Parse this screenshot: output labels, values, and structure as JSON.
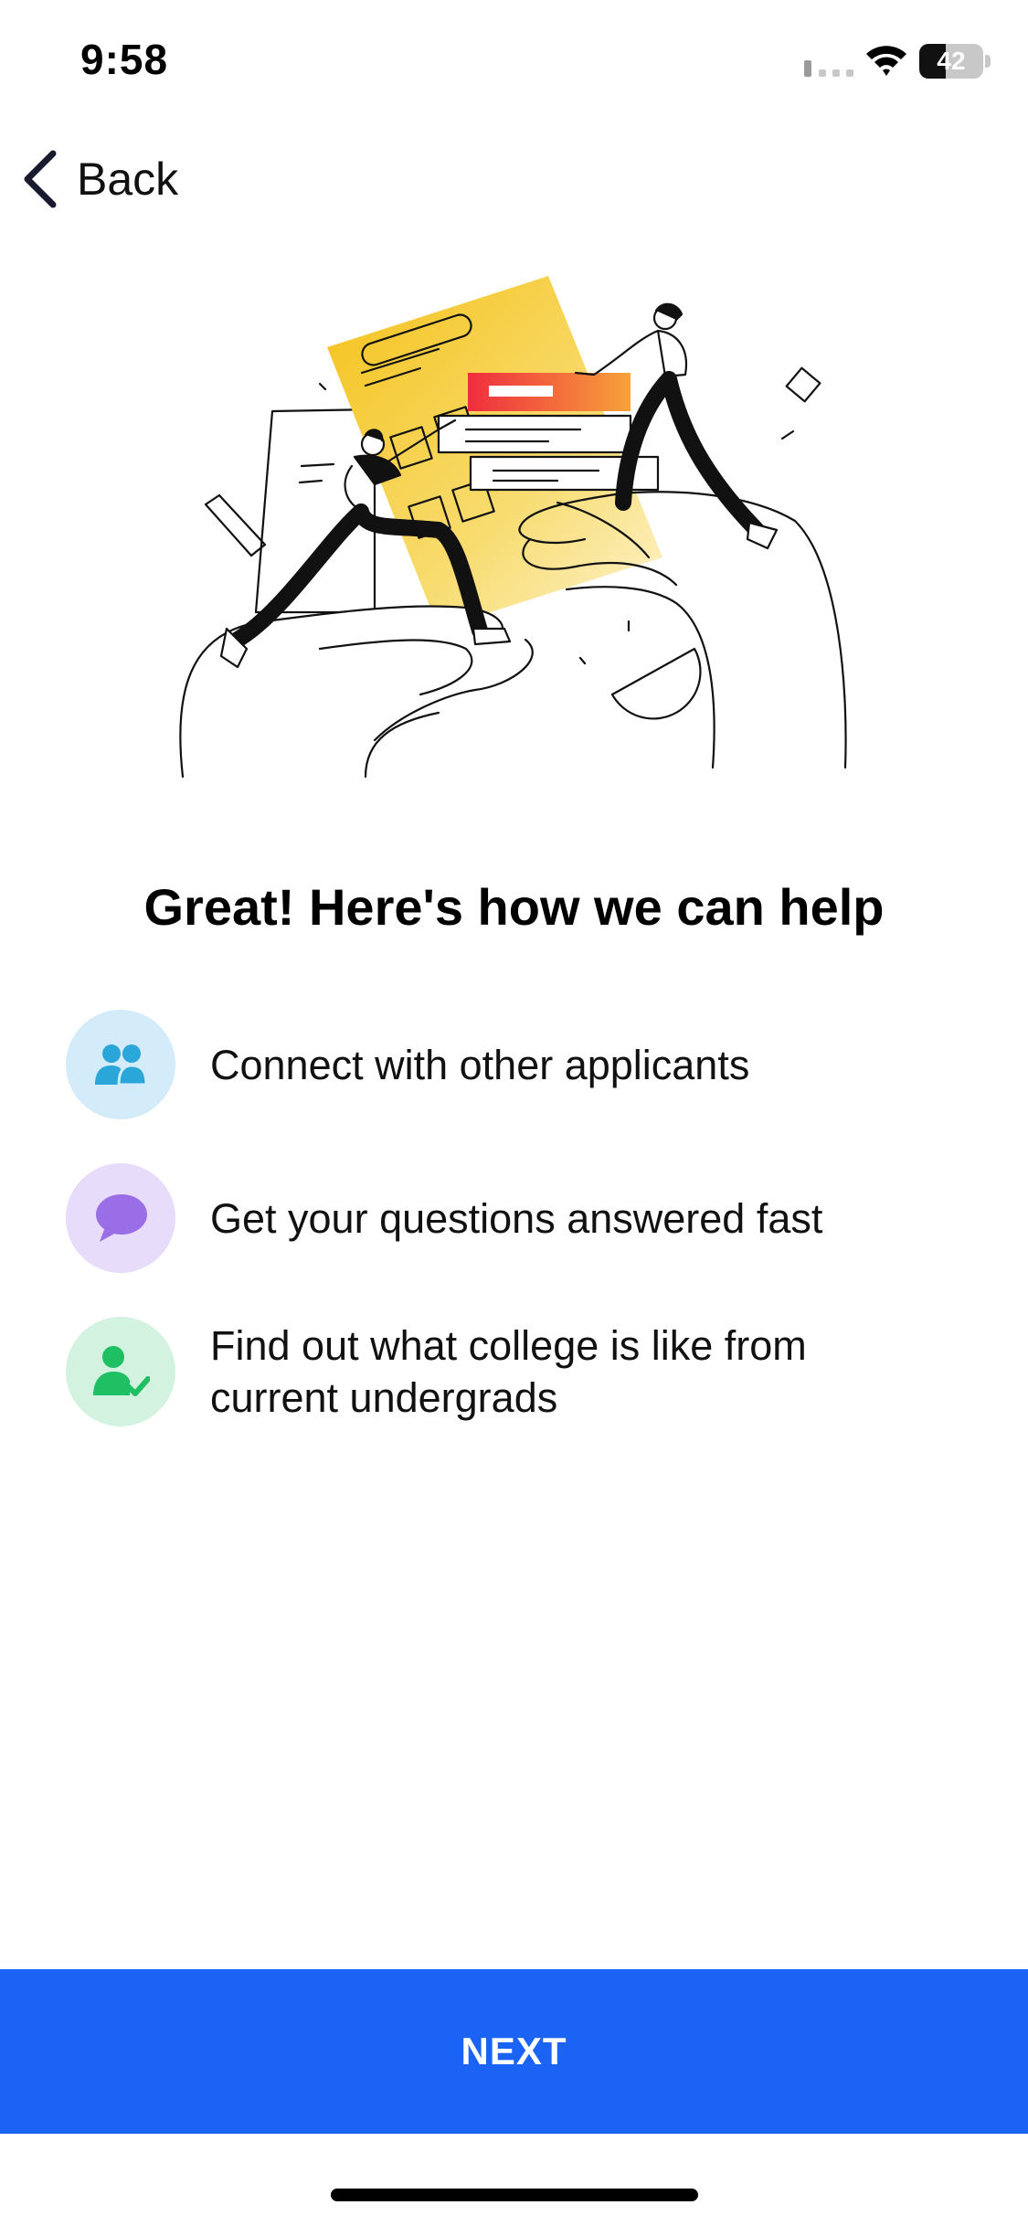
{
  "status_bar": {
    "time": "9:58",
    "battery": "42",
    "battery_level": 0.42,
    "icons": [
      "signal-icon",
      "wifi-icon",
      "battery-icon"
    ]
  },
  "nav": {
    "back_label": "Back",
    "back_icon": "chevron-left-icon"
  },
  "hero": {
    "icon": "people-exchanging-documents-illustration"
  },
  "title": "Great! Here's how we can help",
  "features": [
    {
      "text": "Connect with other applicants",
      "icon": "people-icon",
      "icon_color": "#2aa6d8",
      "bg_color": "#d4ecfa"
    },
    {
      "text": "Get your questions answered fast",
      "icon": "chat-bubble-icon",
      "icon_color": "#9a6ee6",
      "bg_color": "#e8dcfb"
    },
    {
      "text": "Find out what college is like from current undergrads",
      "icon": "verified-user-icon",
      "icon_color": "#1fbf63",
      "bg_color": "#d3f2e0"
    }
  ],
  "next_label": "NEXT",
  "colors": {
    "accent": "#1b63f5",
    "yellow": "#f6c731",
    "red_orange": "#f2433b"
  }
}
